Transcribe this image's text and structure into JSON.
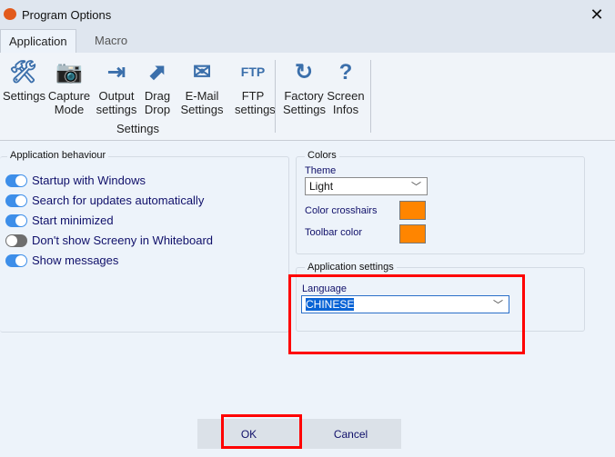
{
  "window": {
    "title": "Program Options",
    "close": "✕"
  },
  "tabs": [
    {
      "label": "Application"
    },
    {
      "label": "Macro"
    }
  ],
  "ribbon": {
    "items": [
      {
        "label": "Settings",
        "icon": "tools-icon",
        "glyph": "🛠"
      },
      {
        "label": "Capture\nMode",
        "icon": "camera-icon",
        "glyph": "📷"
      },
      {
        "label": "Output\nsettings",
        "icon": "output-icon",
        "glyph": "⇥"
      },
      {
        "label": "Drag\nDrop",
        "icon": "drag-drop-icon",
        "glyph": "⬈"
      },
      {
        "label": "E-Mail\nSettings",
        "icon": "mail-icon",
        "glyph": "✉"
      },
      {
        "label": "FTP\nsettings",
        "icon": "ftp-icon",
        "glyph": "FTP"
      },
      {
        "label": "Factory\nSettings",
        "icon": "reset-icon",
        "glyph": "↻"
      },
      {
        "label": "Screen\nInfos",
        "icon": "screen-info-icon",
        "glyph": "?"
      }
    ],
    "group_label": "Settings"
  },
  "behaviour": {
    "title": "Application behaviour",
    "options": [
      {
        "label": "Startup with Windows",
        "on": true
      },
      {
        "label": "Search for updates automatically",
        "on": true
      },
      {
        "label": "Start minimized",
        "on": true
      },
      {
        "label": "Don't show Screeny in Whiteboard",
        "on": false
      },
      {
        "label": "Show messages",
        "on": true
      }
    ]
  },
  "colors": {
    "title": "Colors",
    "theme_label": "Theme",
    "theme_value": "Light",
    "crosshairs_label": "Color crosshairs",
    "toolbar_label": "Toolbar color",
    "swatch": "#ff8500"
  },
  "app_settings": {
    "title": "Application settings",
    "language_label": "Language",
    "language_value": "CHINESE"
  },
  "buttons": {
    "ok": "OK",
    "cancel": "Cancel"
  }
}
